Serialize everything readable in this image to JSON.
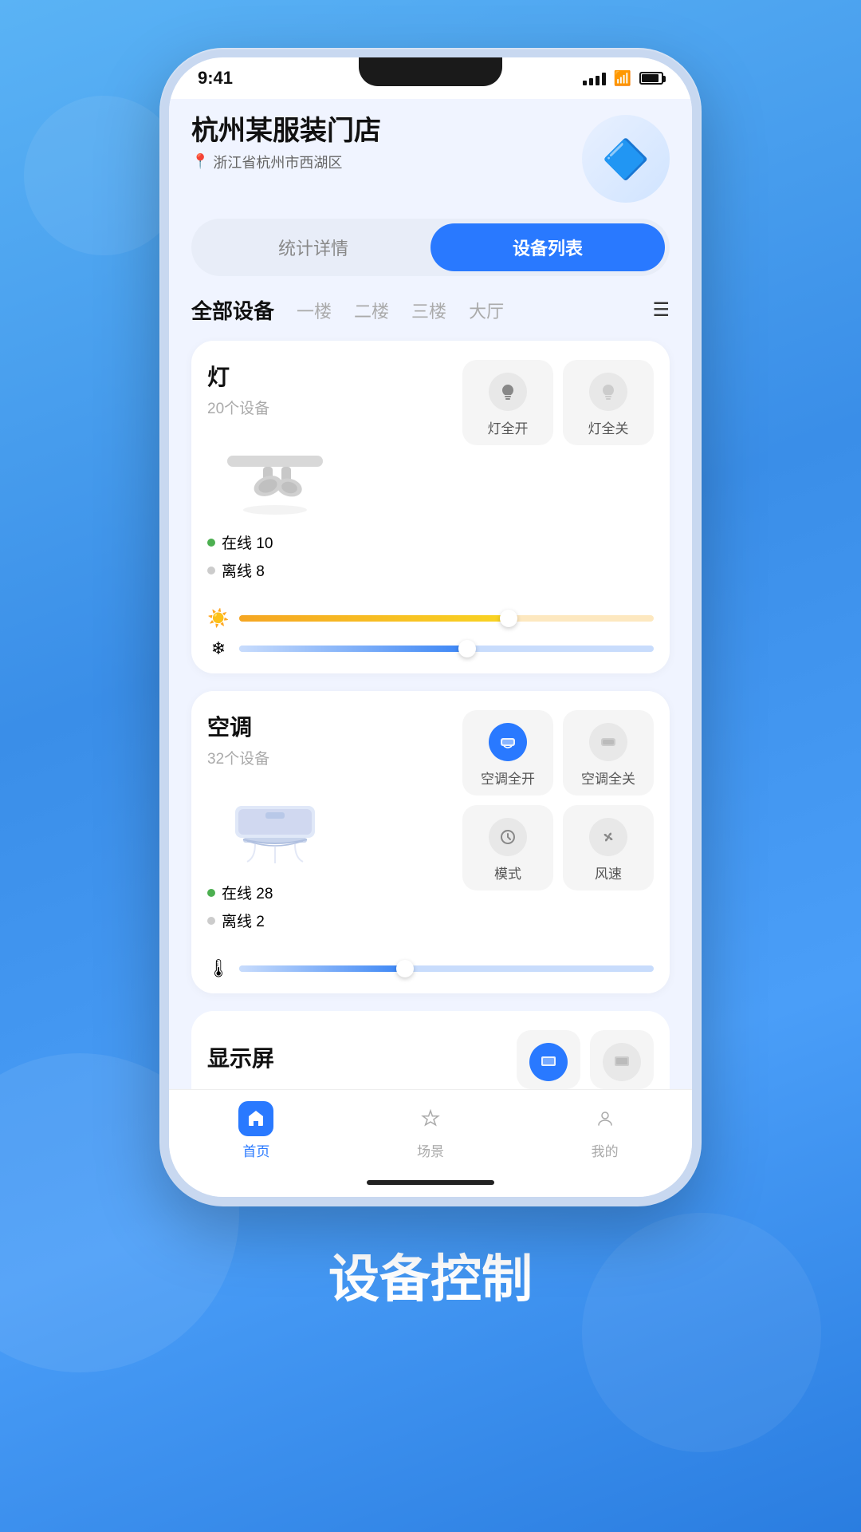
{
  "status_bar": {
    "time": "9:41"
  },
  "header": {
    "store_name": "杭州某服装门店",
    "location": "浙江省杭州市西湖区"
  },
  "tabs": {
    "stats": "统计详情",
    "device_list": "设备列表"
  },
  "floor_filter": {
    "all": "全部设备",
    "f1": "一楼",
    "f2": "二楼",
    "f3": "三楼",
    "lobby": "大厅"
  },
  "devices": [
    {
      "name": "灯",
      "count": "20个设备",
      "online_label": "在线",
      "online_count": "10",
      "offline_label": "离线",
      "offline_count": "8",
      "controls": [
        {
          "label": "灯全开",
          "icon": "💡",
          "active": true
        },
        {
          "label": "灯全关",
          "icon": "💡",
          "active": false
        }
      ],
      "sliders": [
        {
          "icon": "🌡",
          "fill_pct": 65,
          "fill_color": "#f5a623",
          "track_color": "#fde8c0"
        },
        {
          "icon": "✨",
          "fill_pct": 55,
          "fill_color": "#3a85f5",
          "track_color": "#c8dcfc"
        }
      ]
    },
    {
      "name": "空调",
      "count": "32个设备",
      "online_label": "在线",
      "online_count": "28",
      "offline_label": "离线",
      "offline_count": "2",
      "controls": [
        {
          "label": "空调全开",
          "icon": "❄️",
          "active": true
        },
        {
          "label": "空调全关",
          "icon": "❄️",
          "active": false
        }
      ],
      "extra_controls": [
        {
          "label": "模式",
          "icon": "⚙️"
        },
        {
          "label": "风速",
          "icon": "🌀"
        }
      ],
      "sliders": [
        {
          "icon": "🌡",
          "fill_pct": 40,
          "fill_color": "#3a85f5",
          "track_color": "#c8dcfc"
        }
      ]
    },
    {
      "name": "显示屏",
      "count": ""
    }
  ],
  "bottom_nav": {
    "home": "首页",
    "scene": "场景",
    "profile": "我的"
  },
  "page_title": "设备控制"
}
